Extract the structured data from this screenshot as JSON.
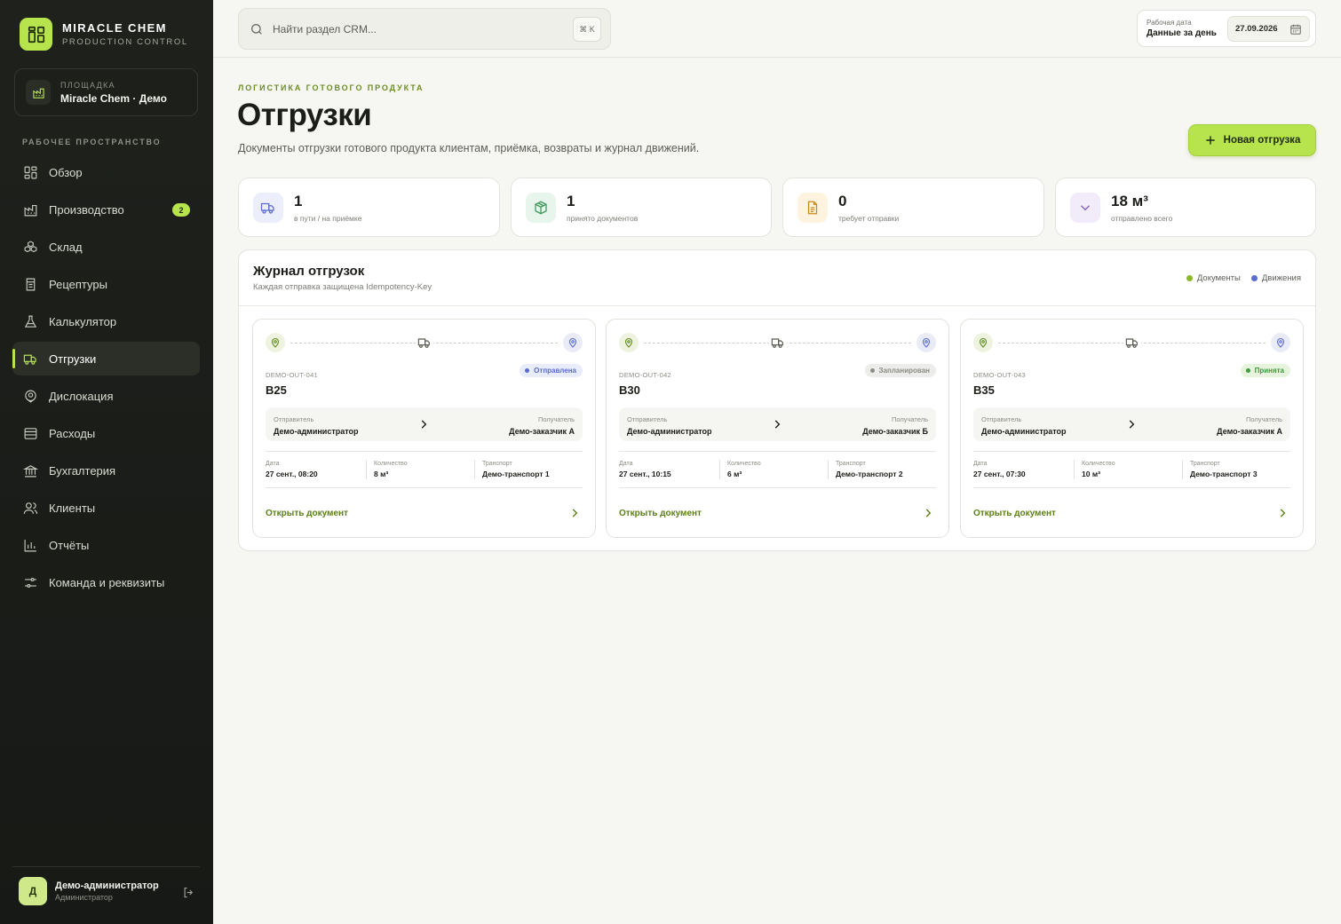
{
  "brand": {
    "name": "MIRACLE CHEM",
    "subtitle": "PRODUCTION CONTROL"
  },
  "site": {
    "label": "ПЛОЩАДКА",
    "value": "Miracle Chem · Демо"
  },
  "sidebar": {
    "section_label": "РАБОЧЕЕ ПРОСТРАНСТВО",
    "items": [
      {
        "label": "Обзор",
        "icon": "grid-icon"
      },
      {
        "label": "Производство",
        "icon": "factory-icon",
        "badge": "2"
      },
      {
        "label": "Склад",
        "icon": "boxes-icon"
      },
      {
        "label": "Рецептуры",
        "icon": "clipboard-icon"
      },
      {
        "label": "Калькулятор",
        "icon": "flask-icon"
      },
      {
        "label": "Отгрузки",
        "icon": "truck-icon",
        "active": true
      },
      {
        "label": "Дислокация",
        "icon": "map-pin-icon"
      },
      {
        "label": "Расходы",
        "icon": "wallet-icon"
      },
      {
        "label": "Бухгалтерия",
        "icon": "bank-icon"
      },
      {
        "label": "Клиенты",
        "icon": "users-icon"
      },
      {
        "label": "Отчёты",
        "icon": "bar-chart-icon"
      },
      {
        "label": "Команда и реквизиты",
        "icon": "sliders-icon"
      }
    ]
  },
  "user": {
    "initial": "Д",
    "name": "Демо-администратор",
    "role": "Администратор"
  },
  "search": {
    "placeholder": "Найти раздел CRM...",
    "shortcut": "⌘ K"
  },
  "workdate": {
    "label": "Рабочая дата",
    "sublabel": "Данные за день",
    "value": "27.09.2026"
  },
  "page": {
    "eyebrow": "ЛОГИСТИКА ГОТОВОГО ПРОДУКТА",
    "title": "Отгрузки",
    "description": "Документы отгрузки готового продукта клиентам, приёмка, возвраты и журнал движений.",
    "new_button": "Новая отгрузка"
  },
  "stats": [
    {
      "value": "1",
      "label": "в пути / на приёмке",
      "icon": "truck-icon",
      "color": "#5b6bd1",
      "bg": "#eceefb"
    },
    {
      "value": "1",
      "label": "принято документов",
      "icon": "package-check-icon",
      "color": "#3f9a5a",
      "bg": "#e8f5ec"
    },
    {
      "value": "0",
      "label": "требует отправки",
      "icon": "document-icon",
      "color": "#c98a1c",
      "bg": "#fdf3de"
    },
    {
      "value": "18 м³",
      "label": "отправлено всего",
      "icon": "chevron-down-icon",
      "color": "#8a65c9",
      "bg": "#f1ebfa"
    }
  ],
  "journal": {
    "title": "Журнал отгрузок",
    "subtitle": "Каждая отправка защищена Idempotency-Key",
    "legend": [
      {
        "label": "Документы",
        "color": "#8bb72a"
      },
      {
        "label": "Движения",
        "color": "#5b6bd1"
      }
    ]
  },
  "labels": {
    "sender": "Отправитель",
    "receiver": "Получатель",
    "date": "Дата",
    "quantity": "Количество",
    "transport": "Транспорт",
    "open": "Открыть документ"
  },
  "shipments": [
    {
      "code": "DEMO-OUT-041",
      "name": "B25",
      "status": "Отправлена",
      "status_color": "#5b6bd1",
      "status_bg": "#e9ecfa",
      "sender": "Демо-администратор",
      "receiver": "Демо-заказчик А",
      "date": "27 сент., 08:20",
      "quantity": "8 м³",
      "transport": "Демо-транспорт 1"
    },
    {
      "code": "DEMO-OUT-042",
      "name": "B30",
      "status": "Запланирован",
      "status_color": "#8a8d85",
      "status_bg": "#ececea",
      "sender": "Демо-администратор",
      "receiver": "Демо-заказчик Б",
      "date": "27 сент., 10:15",
      "quantity": "6 м³",
      "transport": "Демо-транспорт 2"
    },
    {
      "code": "DEMO-OUT-043",
      "name": "B35",
      "status": "Принята",
      "status_color": "#3f9a3a",
      "status_bg": "#e6f4dd",
      "sender": "Демо-администратор",
      "receiver": "Демо-заказчик А",
      "date": "27 сент., 07:30",
      "quantity": "10 м³",
      "transport": "Демо-транспорт 3"
    }
  ]
}
